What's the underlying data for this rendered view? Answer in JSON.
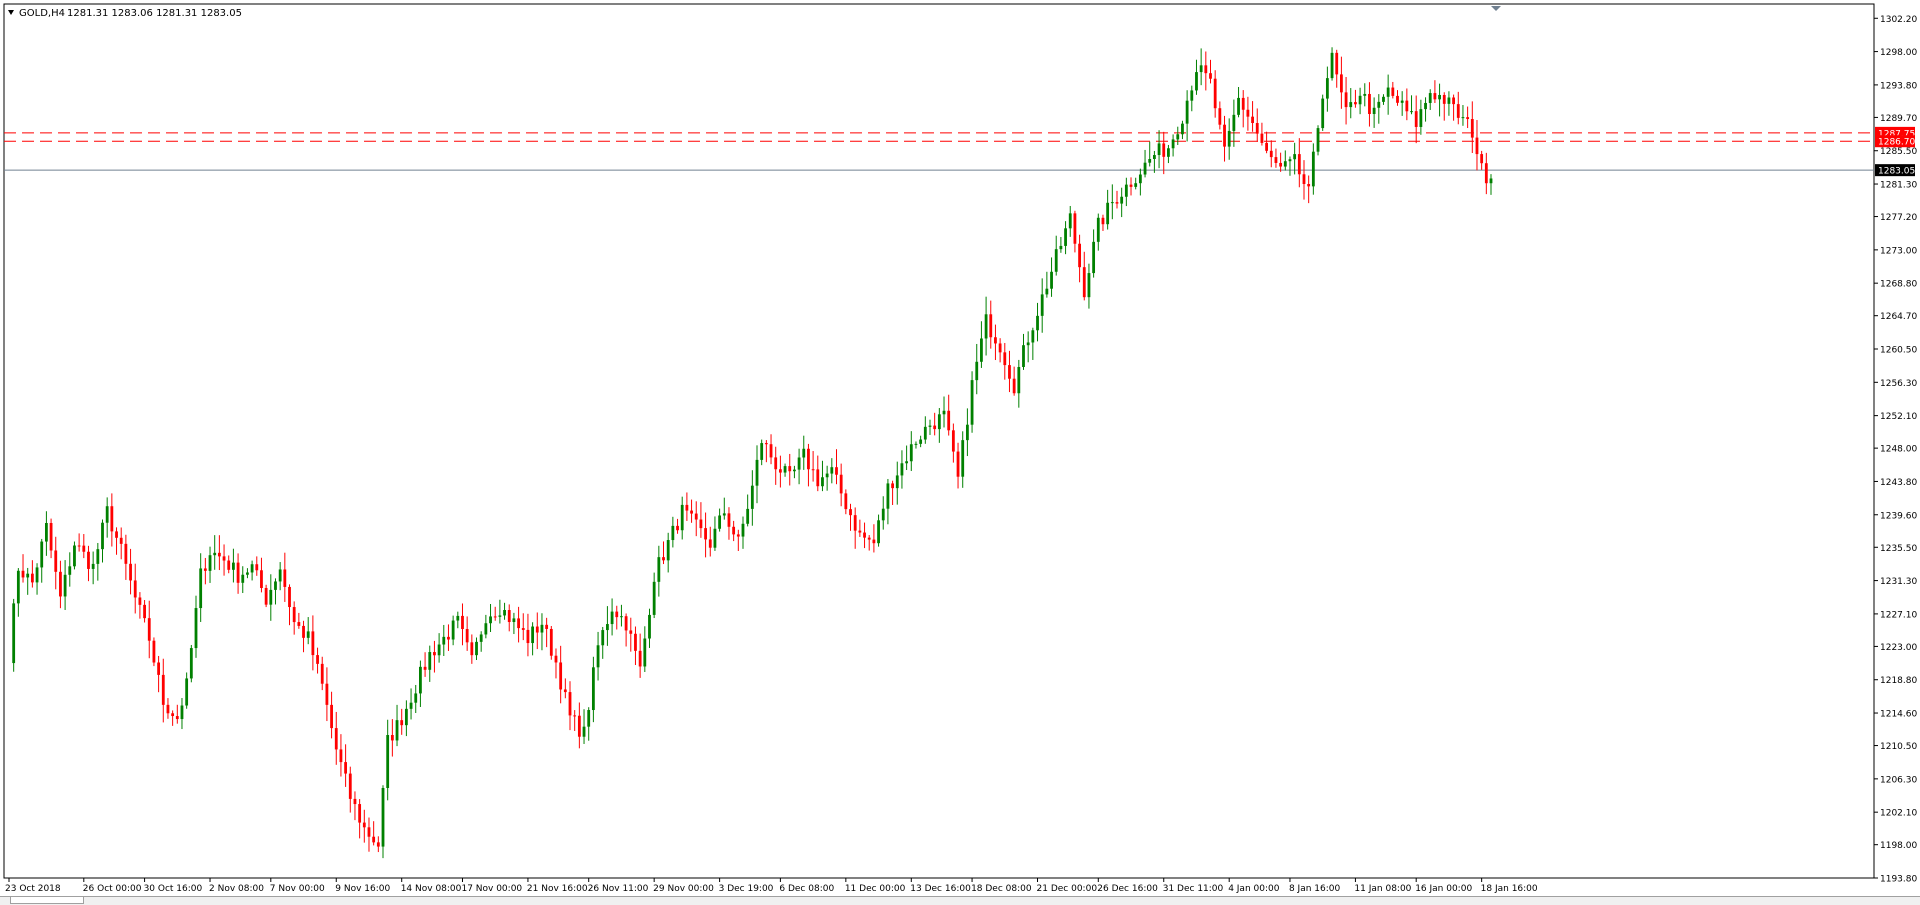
{
  "header": {
    "symbol": "GOLD,H4",
    "ohlc": "1281.31 1283.06 1281.31 1283.05"
  },
  "colors": {
    "up": "#008000",
    "down": "#ff0000",
    "grid": "#ffffff",
    "axis": "#000000",
    "bid_line": "#708090",
    "level_line": "#ff0000",
    "bid_label_bg": "#000000",
    "level_label_bg": "#ff0000"
  },
  "chart_data": {
    "type": "candlestick",
    "title": "GOLD,H4",
    "ylim": [
      1193.8,
      1304.0
    ],
    "y_ticks": [
      "1302.20",
      "1298.00",
      "1293.80",
      "1289.70",
      "1285.50",
      "1281.30",
      "1277.20",
      "1273.00",
      "1268.80",
      "1264.70",
      "1260.50",
      "1256.30",
      "1252.10",
      "1248.00",
      "1243.80",
      "1239.60",
      "1235.50",
      "1231.30",
      "1227.10",
      "1223.00",
      "1218.80",
      "1214.60",
      "1210.50",
      "1206.30",
      "1202.10",
      "1198.00",
      "1193.80"
    ],
    "x_labels": [
      "23 Oct 2018",
      "26 Oct 00:00",
      "30 Oct 16:00",
      "2 Nov 08:00",
      "7 Nov 00:00",
      "9 Nov 16:00",
      "14 Nov 08:00",
      "17 Nov 00:00",
      "21 Nov 16:00",
      "26 Nov 11:00",
      "29 Nov 00:00",
      "3 Dec 19:00",
      "6 Dec 08:00",
      "11 Dec 00:00",
      "13 Dec 16:00",
      "18 Dec 08:00",
      "21 Dec 00:00",
      "26 Dec 16:00",
      "31 Dec 11:00",
      "4 Jan 00:00",
      "8 Jan 16:00",
      "11 Jan 08:00",
      "16 Jan 00:00",
      "18 Jan 16:00"
    ],
    "current_price": {
      "value": 1283.05,
      "label": "1283.05"
    },
    "levels": [
      {
        "value": 1287.75,
        "label": "1287.75"
      },
      {
        "value": 1286.7,
        "label": "1286.70"
      }
    ],
    "anchors": [
      [
        0,
        1222
      ],
      [
        2,
        1233
      ],
      [
        5,
        1231
      ],
      [
        8,
        1238
      ],
      [
        11,
        1229
      ],
      [
        14,
        1236
      ],
      [
        18,
        1233
      ],
      [
        21,
        1240
      ],
      [
        24,
        1235
      ],
      [
        27,
        1229
      ],
      [
        30,
        1224
      ],
      [
        33,
        1216
      ],
      [
        36,
        1214
      ],
      [
        38,
        1218
      ],
      [
        41,
        1232
      ],
      [
        43,
        1235
      ],
      [
        46,
        1234
      ],
      [
        49,
        1232
      ],
      [
        52,
        1233
      ],
      [
        55,
        1229
      ],
      [
        58,
        1233
      ],
      [
        61,
        1226
      ],
      [
        64,
        1224
      ],
      [
        67,
        1218
      ],
      [
        70,
        1210
      ],
      [
        73,
        1204
      ],
      [
        76,
        1200
      ],
      [
        79,
        1198
      ],
      [
        81,
        1211
      ],
      [
        84,
        1214
      ],
      [
        87,
        1218
      ],
      [
        90,
        1222
      ],
      [
        93,
        1224
      ],
      [
        96,
        1226
      ],
      [
        99,
        1221
      ],
      [
        102,
        1227
      ],
      [
        105,
        1228
      ],
      [
        108,
        1226
      ],
      [
        111,
        1224
      ],
      [
        114,
        1226
      ],
      [
        117,
        1221
      ],
      [
        120,
        1214
      ],
      [
        123,
        1212
      ],
      [
        126,
        1223
      ],
      [
        129,
        1228
      ],
      [
        132,
        1226
      ],
      [
        135,
        1220
      ],
      [
        138,
        1232
      ],
      [
        141,
        1236
      ],
      [
        144,
        1240
      ],
      [
        147,
        1238
      ],
      [
        150,
        1236
      ],
      [
        153,
        1240
      ],
      [
        156,
        1236
      ],
      [
        159,
        1243
      ],
      [
        161,
        1249
      ],
      [
        164,
        1246
      ],
      [
        167,
        1244
      ],
      [
        170,
        1247
      ],
      [
        173,
        1244
      ],
      [
        176,
        1245
      ],
      [
        179,
        1241
      ],
      [
        182,
        1237
      ],
      [
        185,
        1236
      ],
      [
        188,
        1243
      ],
      [
        191,
        1246
      ],
      [
        194,
        1249
      ],
      [
        197,
        1251
      ],
      [
        200,
        1252
      ],
      [
        203,
        1244
      ],
      [
        206,
        1256
      ],
      [
        209,
        1264
      ],
      [
        212,
        1261
      ],
      [
        215,
        1256
      ],
      [
        218,
        1262
      ],
      [
        221,
        1267
      ],
      [
        224,
        1272
      ],
      [
        227,
        1277
      ],
      [
        230,
        1268
      ],
      [
        233,
        1276
      ],
      [
        236,
        1279
      ],
      [
        239,
        1281
      ],
      [
        242,
        1283
      ],
      [
        245,
        1285
      ],
      [
        248,
        1286
      ],
      [
        251,
        1290
      ],
      [
        254,
        1296
      ],
      [
        257,
        1294
      ],
      [
        260,
        1285
      ],
      [
        263,
        1292
      ],
      [
        266,
        1289
      ],
      [
        269,
        1285
      ],
      [
        272,
        1283
      ],
      [
        275,
        1284
      ],
      [
        278,
        1280
      ],
      [
        281,
        1293
      ],
      [
        283,
        1297
      ],
      [
        286,
        1290
      ],
      [
        289,
        1293
      ],
      [
        292,
        1290
      ],
      [
        295,
        1293
      ],
      [
        298,
        1291
      ],
      [
        301,
        1289
      ],
      [
        304,
        1293
      ],
      [
        307,
        1292
      ],
      [
        310,
        1290
      ],
      [
        313,
        1288
      ],
      [
        315,
        1283
      ],
      [
        317,
        1282
      ]
    ]
  }
}
